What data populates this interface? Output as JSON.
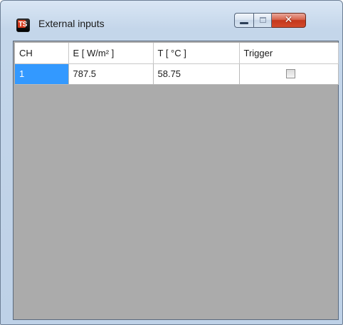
{
  "window": {
    "title": "External inputs",
    "icon_text": "TS",
    "controls": {
      "minimize": "minimize-icon",
      "maximize": "maximize-icon",
      "close": "close-icon"
    }
  },
  "table": {
    "columns": [
      "CH",
      "E [ W/m² ]",
      "T [ °C ]",
      "Trigger"
    ],
    "rows": [
      {
        "ch": "1",
        "e": "787.5",
        "t": "58.75",
        "trigger_checked": false
      }
    ]
  },
  "colors": {
    "selection": "#3399ff",
    "empty_area": "#ababab",
    "close_button": "#c4371c"
  }
}
